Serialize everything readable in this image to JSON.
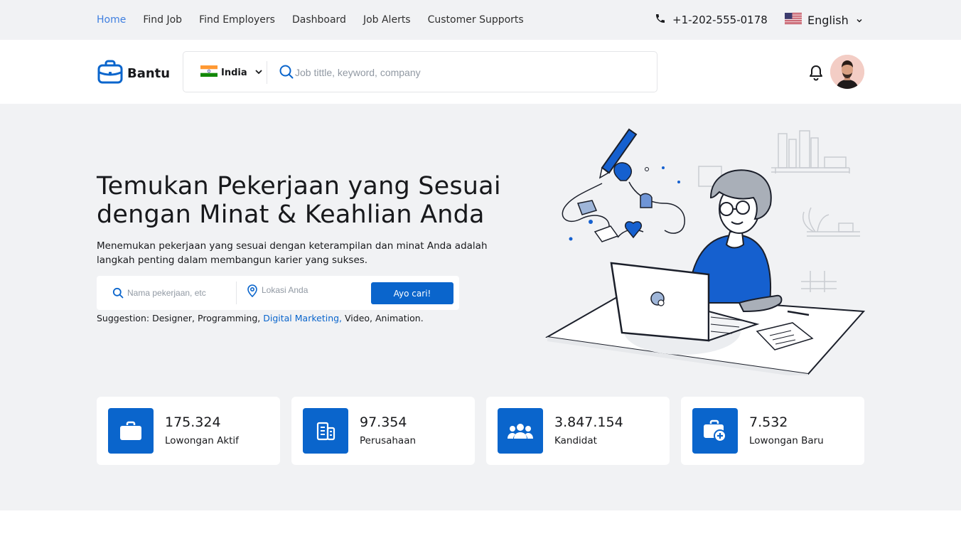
{
  "topbar": {
    "nav": [
      {
        "label": "Home",
        "active": true
      },
      {
        "label": "Find Job",
        "active": false
      },
      {
        "label": "Find Employers",
        "active": false
      },
      {
        "label": "Dashboard",
        "active": false
      },
      {
        "label": "Job Alerts",
        "active": false
      },
      {
        "label": "Customer Supports",
        "active": false
      }
    ],
    "phone": "+1-202-555-0178",
    "language": "English"
  },
  "header": {
    "brand": "Bantu",
    "country": "India",
    "search_placeholder": "Job tittle, keyword, company"
  },
  "hero": {
    "title_line1": "Temukan Pekerjaan yang Sesuai",
    "title_line2": "dengan Minat & Keahlian Anda",
    "description_line1": "Menemukan pekerjaan yang sesuai dengan keterampilan dan minat Anda adalah",
    "description_line2": "langkah penting dalam membangun karier yang sukses.",
    "job_placeholder": "Nama pekerjaan, etc",
    "location_placeholder": "Lokasi Anda",
    "search_button": "Ayo cari!",
    "suggestion_prefix": "Suggestion: ",
    "suggestions": [
      {
        "label": "Designer,",
        "highlight": false
      },
      {
        "label": "Programming,",
        "highlight": false
      },
      {
        "label": "Digital Marketing,",
        "highlight": true
      },
      {
        "label": "Video,",
        "highlight": false
      },
      {
        "label": "Animation.",
        "highlight": false
      }
    ]
  },
  "stats": [
    {
      "value": "175.324",
      "label": "Lowongan Aktif",
      "icon": "briefcase-icon"
    },
    {
      "value": "97.354",
      "label": "Perusahaan",
      "icon": "building-icon"
    },
    {
      "value": "3.847.154",
      "label": "Kandidat",
      "icon": "users-icon"
    },
    {
      "value": "7.532",
      "label": "Lowongan Baru",
      "icon": "briefcase-plus-icon"
    }
  ],
  "colors": {
    "primary": "#0a65cc",
    "nav_active": "#3f7fe0",
    "background_gray": "#f1f2f4"
  }
}
